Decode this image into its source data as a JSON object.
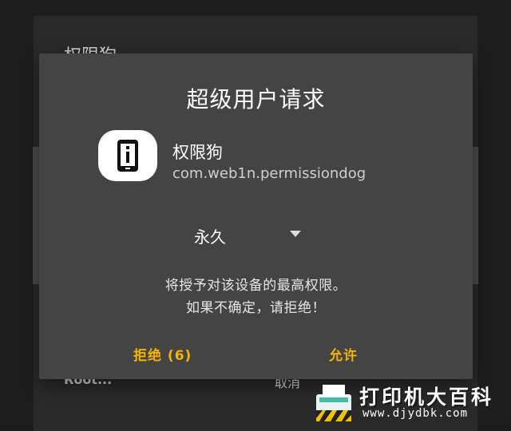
{
  "background": {
    "title": "权限狗",
    "bottom_left": "Root...",
    "bottom_right": "取消"
  },
  "dialog": {
    "title": "超级用户请求",
    "app": {
      "name": "权限狗",
      "package": "com.web1n.permissiondog",
      "icon": "phone-info-icon"
    },
    "duration": {
      "selected": "永久",
      "icon": "triangle-down-icon"
    },
    "warning": {
      "line1": "将授予对该设备的最高权限。",
      "line2": "如果不确定，请拒绝！"
    },
    "buttons": {
      "deny_label": "拒绝 (6)",
      "allow_label": "允许"
    }
  },
  "watermark": {
    "text": "打印机大百科",
    "url": "www.djydbk.com",
    "icon": "printer-icon"
  },
  "colors": {
    "dialog_bg": "#444444",
    "accent": "#f5b400",
    "page_bg": "#1e1e1e"
  }
}
